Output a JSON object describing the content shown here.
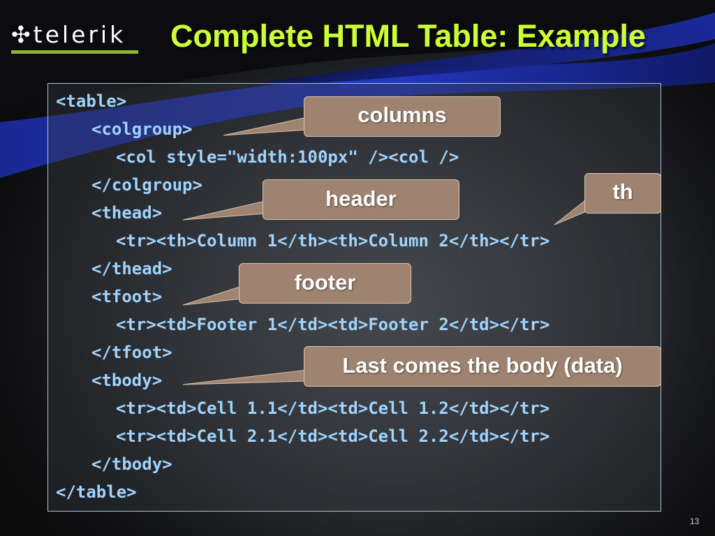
{
  "logo": {
    "text": "telerik"
  },
  "slide": {
    "title": "Complete HTML Table: Example",
    "page_number": "13"
  },
  "code_lines": [
    "<table>",
    "<colgroup>",
    "<col style=\"width:100px\" /><col />",
    "</colgroup>",
    "<thead>",
    "<tr><th>Column 1</th><th>Column 2</th></tr>",
    "</thead>",
    "<tfoot>",
    "<tr><td>Footer 1</td><td>Footer 2</td></tr>",
    "</tfoot>",
    "<tbody>",
    "<tr><td>Cell 1.1</td><td>Cell 1.2</td></tr>",
    "<tr><td>Cell 2.1</td><td>Cell 2.2</td></tr>",
    "</tbody>",
    "</table>"
  ],
  "callouts": {
    "columns": "columns",
    "header": "header",
    "th": "th",
    "footer": "footer",
    "body": "Last comes the body (data)"
  },
  "colors": {
    "title": "#ccff33",
    "code": "#9ed4ff",
    "callout_fill": "#9e8470",
    "logo_bar": "#8ab833"
  }
}
